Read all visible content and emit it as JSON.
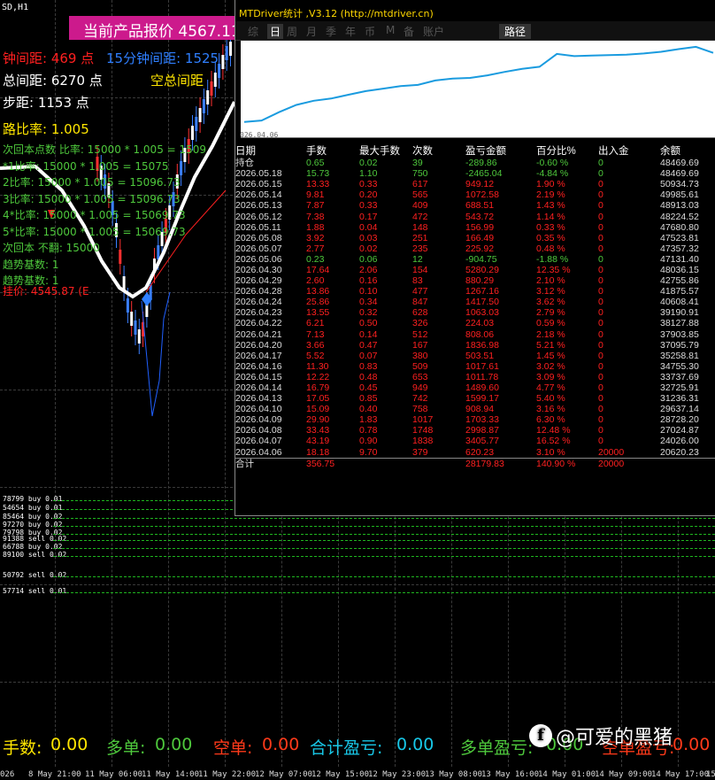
{
  "chart": {
    "symbol": "SD,H1",
    "price_banner": "当前产品报价 4567.11",
    "overlay": {
      "line1_left": "钟间距: 469 点",
      "line1_right": "15分钟间距: 1525",
      "line2_left": "总间距: 6270 点",
      "line2_right": "空总间距",
      "line3": "步距: 1153 点",
      "line4": "路比率: 1.005",
      "green_lines": [
        "次回本点数 比率: 15000 * 1.005 = 1509",
        "*1比率: 15000 * 1.005 = 15075",
        "2比率: 15000 * 1.005 = 15096.73",
        "3比率: 15000 * 1.005 = 15096.73",
        "4*比率: 15000 * 1.005 = 15069.73",
        "5*比率: 15000 * 1.005 = 15069.73",
        "次回本 不翻: 15000",
        "趋势基数: 1",
        "趋势基数: 1"
      ],
      "red_line": "挂价: 4545.87 (E"
    },
    "orders": [
      "78799 buy 0.01",
      "54654 buy 0.01",
      "85464 buy 0.02",
      "97270 buy 0.02",
      "79798 buy 0.02",
      "91388 sell 0.02",
      "66788 buy 0.02",
      "89100 sell 0.02",
      "50792 sell 0.02",
      "57714 sell 0.01"
    ],
    "bottom_stats": {
      "lots_label": "手数:",
      "lots_value": "0.00",
      "buy_label": "多单:",
      "buy_value": "0.00",
      "sell_label": "空单:",
      "sell_value": "0.00",
      "pl_label": "合计盈亏:",
      "pl_value": "0.00",
      "buy_pl_label": "多单盈亏:",
      "buy_pl_value": "0.00",
      "sell_pl_label": "空单盈亏:",
      "sell_pl_value": "0.00"
    },
    "time_labels": [
      "026",
      "8 May 21:00",
      "11 May 06:00",
      "11 May 14:00",
      "11 May 22:00",
      "12 May 07:00",
      "12 May 15:00",
      "12 May 23:00",
      "13 May 08:00",
      "13 May 16:00",
      "14 May 01:00",
      "14 May 09:00",
      "14 May 17:00",
      "15"
    ],
    "watermark": "@可爱的黑猪",
    "colors": {
      "accent_pink": "#cc1a8c",
      "green": "#4ec83c",
      "red": "#ff2020",
      "blue": "#2f7fff",
      "yellow": "#ffe600"
    }
  },
  "panel": {
    "title": "MTDriver统计 ,V3.12 (http://mtdriver.cn)",
    "tabs": [
      "综",
      "日",
      "周",
      "月",
      "季",
      "年",
      "币",
      "M",
      "备",
      "账户"
    ],
    "active_tab": "日",
    "path_button": "路径",
    "equity_start_date": "026.04.06",
    "columns": [
      "日期",
      "手数",
      "最大手数",
      "次数",
      "盈亏金额",
      "百分比%",
      "出入金",
      "余额"
    ],
    "holding": {
      "label": "持仓",
      "lots": "0.65",
      "max_lots": "0.02",
      "count": "39",
      "pl": "-289.86",
      "pct": "-0.60 %",
      "io": "0",
      "balance": "48469.69"
    },
    "rows": [
      {
        "date": "2026.05.18",
        "lots": "15.73",
        "max_lots": "1.10",
        "count": "750",
        "pl": "-2465.04",
        "pct": "-4.84 %",
        "io": "0",
        "balance": "48469.69",
        "sign": "neg"
      },
      {
        "date": "2026.05.15",
        "lots": "13.33",
        "max_lots": "0.33",
        "count": "617",
        "pl": "949.12",
        "pct": "1.90 %",
        "io": "0",
        "balance": "50934.73",
        "sign": "pos"
      },
      {
        "date": "2026.05.14",
        "lots": "9.81",
        "max_lots": "0.20",
        "count": "565",
        "pl": "1072.58",
        "pct": "2.19 %",
        "io": "0",
        "balance": "49985.61",
        "sign": "pos"
      },
      {
        "date": "2026.05.13",
        "lots": "7.87",
        "max_lots": "0.33",
        "count": "409",
        "pl": "688.51",
        "pct": "1.43 %",
        "io": "0",
        "balance": "48913.03",
        "sign": "pos"
      },
      {
        "date": "2026.05.12",
        "lots": "7.38",
        "max_lots": "0.17",
        "count": "472",
        "pl": "543.72",
        "pct": "1.14 %",
        "io": "0",
        "balance": "48224.52",
        "sign": "pos"
      },
      {
        "date": "2026.05.11",
        "lots": "1.88",
        "max_lots": "0.04",
        "count": "148",
        "pl": "156.99",
        "pct": "0.33 %",
        "io": "0",
        "balance": "47680.80",
        "sign": "pos"
      },
      {
        "date": "2026.05.08",
        "lots": "3.92",
        "max_lots": "0.03",
        "count": "251",
        "pl": "166.49",
        "pct": "0.35 %",
        "io": "0",
        "balance": "47523.81",
        "sign": "pos"
      },
      {
        "date": "2026.05.07",
        "lots": "2.77",
        "max_lots": "0.02",
        "count": "235",
        "pl": "225.92",
        "pct": "0.48 %",
        "io": "0",
        "balance": "47357.32",
        "sign": "pos"
      },
      {
        "date": "2026.05.06",
        "lots": "0.23",
        "max_lots": "0.06",
        "count": "12",
        "pl": "-904.75",
        "pct": "-1.88 %",
        "io": "0",
        "balance": "47131.40",
        "sign": "neg"
      },
      {
        "date": "2026.04.30",
        "lots": "17.64",
        "max_lots": "2.06",
        "count": "154",
        "pl": "5280.29",
        "pct": "12.35 %",
        "io": "0",
        "balance": "48036.15",
        "sign": "pos"
      },
      {
        "date": "2026.04.29",
        "lots": "2.60",
        "max_lots": "0.16",
        "count": "83",
        "pl": "880.29",
        "pct": "2.10 %",
        "io": "0",
        "balance": "42755.86",
        "sign": "pos"
      },
      {
        "date": "2026.04.28",
        "lots": "13.86",
        "max_lots": "0.10",
        "count": "477",
        "pl": "1267.16",
        "pct": "3.12 %",
        "io": "0",
        "balance": "41875.57",
        "sign": "pos"
      },
      {
        "date": "2026.04.24",
        "lots": "25.86",
        "max_lots": "0.34",
        "count": "847",
        "pl": "1417.50",
        "pct": "3.62 %",
        "io": "0",
        "balance": "40608.41",
        "sign": "pos"
      },
      {
        "date": "2026.04.23",
        "lots": "13.55",
        "max_lots": "0.32",
        "count": "628",
        "pl": "1063.03",
        "pct": "2.79 %",
        "io": "0",
        "balance": "39190.91",
        "sign": "pos"
      },
      {
        "date": "2026.04.22",
        "lots": "6.21",
        "max_lots": "0.50",
        "count": "326",
        "pl": "224.03",
        "pct": "0.59 %",
        "io": "0",
        "balance": "38127.88",
        "sign": "pos"
      },
      {
        "date": "2026.04.21",
        "lots": "7.13",
        "max_lots": "0.14",
        "count": "512",
        "pl": "808.06",
        "pct": "2.18 %",
        "io": "0",
        "balance": "37903.85",
        "sign": "pos"
      },
      {
        "date": "2026.04.20",
        "lots": "3.66",
        "max_lots": "0.47",
        "count": "167",
        "pl": "1836.98",
        "pct": "5.21 %",
        "io": "0",
        "balance": "37095.79",
        "sign": "pos"
      },
      {
        "date": "2026.04.17",
        "lots": "5.52",
        "max_lots": "0.07",
        "count": "380",
        "pl": "503.51",
        "pct": "1.45 %",
        "io": "0",
        "balance": "35258.81",
        "sign": "pos"
      },
      {
        "date": "2026.04.16",
        "lots": "11.30",
        "max_lots": "0.83",
        "count": "509",
        "pl": "1017.61",
        "pct": "3.02 %",
        "io": "0",
        "balance": "34755.30",
        "sign": "pos"
      },
      {
        "date": "2026.04.15",
        "lots": "12.22",
        "max_lots": "0.48",
        "count": "653",
        "pl": "1011.78",
        "pct": "3.09 %",
        "io": "0",
        "balance": "33737.69",
        "sign": "pos"
      },
      {
        "date": "2026.04.14",
        "lots": "16.79",
        "max_lots": "0.45",
        "count": "949",
        "pl": "1489.60",
        "pct": "4.77 %",
        "io": "0",
        "balance": "32725.91",
        "sign": "pos"
      },
      {
        "date": "2026.04.13",
        "lots": "17.05",
        "max_lots": "0.85",
        "count": "742",
        "pl": "1599.17",
        "pct": "5.40 %",
        "io": "0",
        "balance": "31236.31",
        "sign": "pos"
      },
      {
        "date": "2026.04.10",
        "lots": "15.09",
        "max_lots": "0.40",
        "count": "758",
        "pl": "908.94",
        "pct": "3.16 %",
        "io": "0",
        "balance": "29637.14",
        "sign": "pos"
      },
      {
        "date": "2026.04.09",
        "lots": "29.90",
        "max_lots": "1.83",
        "count": "1017",
        "pl": "1703.33",
        "pct": "6.30 %",
        "io": "0",
        "balance": "28728.20",
        "sign": "pos"
      },
      {
        "date": "2026.04.08",
        "lots": "33.43",
        "max_lots": "0.78",
        "count": "1748",
        "pl": "2998.87",
        "pct": "12.48 %",
        "io": "0",
        "balance": "27024.87",
        "sign": "pos"
      },
      {
        "date": "2026.04.07",
        "lots": "43.19",
        "max_lots": "0.90",
        "count": "1838",
        "pl": "3405.77",
        "pct": "16.52 %",
        "io": "0",
        "balance": "24026.00",
        "sign": "pos"
      },
      {
        "date": "2026.04.06",
        "lots": "18.18",
        "max_lots": "9.70",
        "count": "379",
        "pl": "620.23",
        "pct": "3.10 %",
        "io": "20000",
        "balance": "20620.23",
        "sign": "pos"
      }
    ],
    "total": {
      "label": "合计",
      "lots": "356.75",
      "max_lots": "",
      "count": "",
      "pl": "28179.83",
      "pct": "140.90 %",
      "io": "20000",
      "balance": ""
    },
    "equity_curve": [
      20000,
      20620.23,
      24026.0,
      27024.87,
      28728.2,
      29637.14,
      31236.31,
      32725.91,
      33737.69,
      34755.3,
      35258.81,
      37095.79,
      37903.85,
      38127.88,
      39190.91,
      40608.41,
      41875.57,
      42755.86,
      48036.15,
      47131.4,
      47357.32,
      47523.81,
      47680.8,
      48224.52,
      48913.03,
      49985.61,
      50934.73,
      48469.69
    ]
  }
}
